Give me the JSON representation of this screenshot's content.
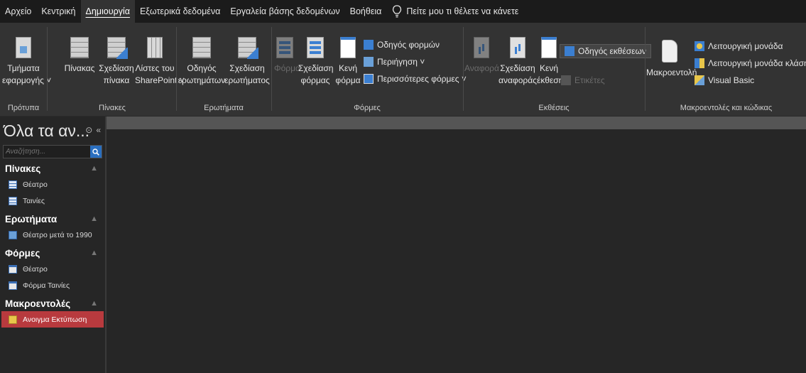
{
  "menu": {
    "items": [
      "Αρχείο",
      "Κεντρική",
      "Δημιουργία",
      "Εξωτερικά δεδομένα",
      "Εργαλεία βάσης δεδομένων",
      "Βοήθεια"
    ],
    "active_index": 2,
    "tell_me": "Πείτε μου τι θέλετε να κάνετε",
    "tell_me_icon": "lightbulb-icon"
  },
  "ribbon": {
    "templates": {
      "label": "Πρότυπα",
      "app_parts_l1": "Τμήματα",
      "app_parts_l2": "εφαρμογής ˅"
    },
    "tables": {
      "label": "Πίνακες",
      "table_l1": "Πίνακας",
      "design_l1": "Σχεδίαση",
      "design_l2": "πίνακα",
      "sp_l1": "Λίστες του",
      "sp_l2": "SharePoint ˅"
    },
    "queries": {
      "label": "Ερωτήματα",
      "wizard_l1": "Οδηγός",
      "wizard_l2": "ερωτημάτων",
      "design_l1": "Σχεδίαση",
      "design_l2": "ερωτήματος"
    },
    "forms": {
      "label": "Φόρμες",
      "form_l1": "Φόρμα",
      "design_l1": "Σχεδίαση",
      "design_l2": "φόρμας",
      "blank_l1": "Κενή",
      "blank_l2": "φόρμα",
      "wizard": "Οδηγός φορμών",
      "navigation": "Περιήγηση ˅",
      "more": "Περισσότερες φόρμες ˅"
    },
    "reports": {
      "label": "Εκθέσεις",
      "report_l1": "Αναφορά",
      "design_l1": "Σχεδίαση",
      "design_l2": "αναφοράς",
      "blank_l1": "Κενή",
      "blank_l2": "έκθεση",
      "wizard": "Οδηγός εκθέσεων",
      "labels": "Ετικέτες"
    },
    "macros": {
      "label": "Μακροεντολές και κώδικας",
      "macro": "Μακροεντολή",
      "module": "Λειτουργική μονάδα",
      "class_module": "Λειτουργική μονάδα κλάσης",
      "vb": "Visual Basic"
    }
  },
  "nav": {
    "title": "Όλα τα αν...",
    "search_placeholder": "Αναζήτηση...",
    "sections": {
      "tables": {
        "title": "Πίνακες",
        "items": [
          "Θέατρο",
          "Ταινίες"
        ]
      },
      "queries": {
        "title": "Ερωτήματα",
        "items": [
          "Θέατρο μετά το 1990"
        ]
      },
      "forms": {
        "title": "Φόρμες",
        "items": [
          "Θέατρο",
          "Φόρμα Ταινίες"
        ]
      },
      "macros": {
        "title": "Μακροεντολές",
        "items": [
          "Ανοιγμα Εκτύπωση"
        ]
      }
    }
  }
}
